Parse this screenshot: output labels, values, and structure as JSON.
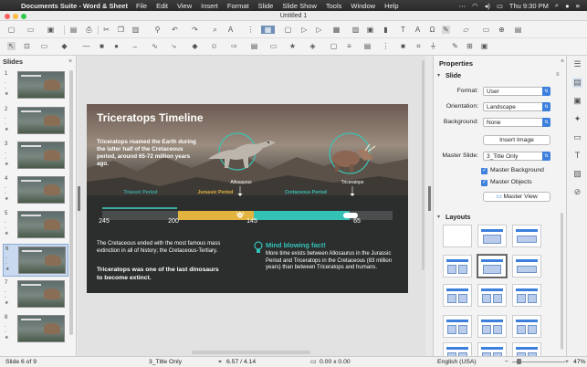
{
  "menubar": {
    "app_name": "Documents Suite - Word & Sheet",
    "items": [
      "File",
      "Edit",
      "View",
      "Insert",
      "Format",
      "Slide",
      "Slide Show",
      "Tools",
      "Window",
      "Help"
    ],
    "clock": "Thu 9:30 PM"
  },
  "window": {
    "title": "Untitled 1"
  },
  "slides_pane": {
    "title": "Slides",
    "thumbnails": [
      "1",
      "2",
      "3",
      "4",
      "5",
      "6",
      "7",
      "8"
    ],
    "selected_index": 6
  },
  "slide": {
    "title": "Triceratops Timeline",
    "intro": "Triceratops roamed the Earth during the latter half of the Cretaceous period, around 65-72 million years ago.",
    "allosaurus_label": "Allosaurus",
    "triceratops_label": "Triceratops",
    "periods": [
      "Triassic Period",
      "Jurassic Period",
      "Cretaceous Period"
    ],
    "ticks": [
      "245",
      "200",
      "145",
      "65"
    ],
    "marker_value": "150",
    "body_text": "The Cretaceous ended with the most famous mass extinction in all of history; the Cretaceous-Tertiary.",
    "body_bold": "Triceratops was one of the last dinosaurs to become extinct.",
    "mind_title": "Mind blowing fact!",
    "mind_text": "More time exists between Allosaurus in the Jurassic Period and Triceratops in the Cretaceous (83 million years) than between Triceratops and humans.",
    "colors": {
      "triassic": "#3aa9a0",
      "jurassic": "#e2b43f",
      "cretaceous": "#34c2b6"
    }
  },
  "properties": {
    "title": "Properties",
    "section_slide": "Slide",
    "format_label": "Format:",
    "format_value": "User",
    "orientation_label": "Orientation:",
    "orientation_value": "Landscape",
    "background_label": "Background:",
    "background_value": "None",
    "insert_image": "Insert Image",
    "master_slide_label": "Master Slide:",
    "master_slide_value": "3_Title Only",
    "master_background": "Master Background",
    "master_objects": "Master Objects",
    "master_view": "Master View",
    "section_layouts": "Layouts"
  },
  "statusbar": {
    "slide_info": "Slide 6 of 9",
    "layout_name": "3_Title Only",
    "position": "6.57 / 4.14",
    "size": "0.00 x 0.00",
    "language": "English (USA)",
    "zoom": "47%"
  }
}
